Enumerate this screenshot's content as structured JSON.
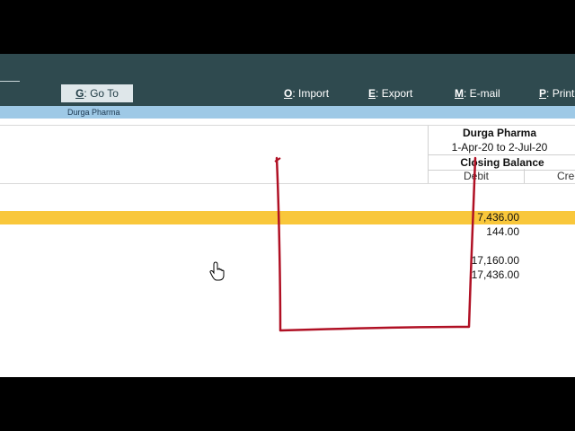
{
  "toolbar": {
    "goto": {
      "key": "G",
      "sep": ":",
      "label": " Go To"
    },
    "import": {
      "key": "O",
      "sep": ":",
      "label": " Import"
    },
    "export": {
      "key": "E",
      "sep": ":",
      "label": " Export"
    },
    "email": {
      "key": "M",
      "sep": ":",
      "label": " E-mail"
    },
    "print": {
      "key": "P",
      "sep": ":",
      "label": " Print"
    }
  },
  "company_small": "Durga Pharma",
  "report_header": {
    "company": "Durga Pharma",
    "period": "1-Apr-20 to 2-Jul-20",
    "column_title": "Closing Balance",
    "debit_label": "Debit",
    "credit_label": "Credit"
  },
  "rows": [
    {
      "debit": "7,436.00"
    },
    {
      "debit": "144.00"
    },
    {
      "debit": "17,160.00"
    },
    {
      "debit": "17,436.00"
    }
  ],
  "colors": {
    "toolbar": "#2f4a4f",
    "band": "#9ec9e6",
    "highlight": "#f9c73b",
    "annotation": "#b01024"
  }
}
